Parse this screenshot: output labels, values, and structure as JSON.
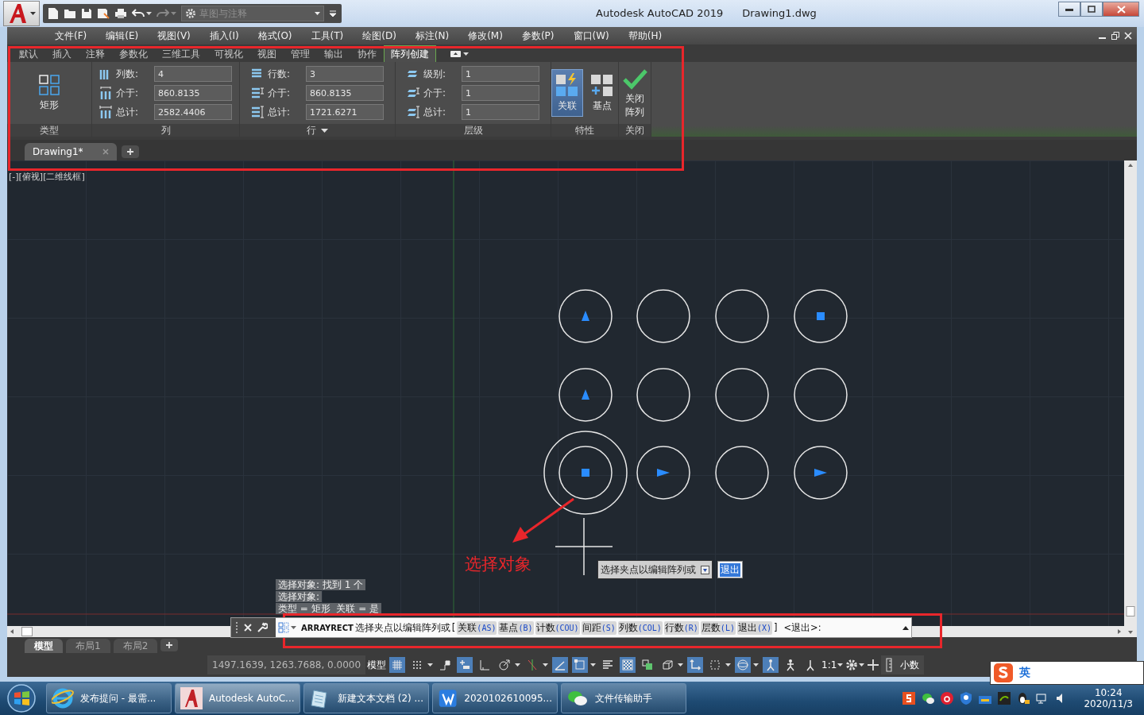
{
  "quick_access": {
    "workspace": "草图与注释"
  },
  "title": {
    "app": "Autodesk AutoCAD 2019",
    "file": "Drawing1.dwg"
  },
  "menu": [
    "文件(F)",
    "编辑(E)",
    "视图(V)",
    "插入(I)",
    "格式(O)",
    "工具(T)",
    "绘图(D)",
    "标注(N)",
    "修改(M)",
    "参数(P)",
    "窗口(W)",
    "帮助(H)"
  ],
  "ribbon": {
    "tabs": [
      {
        "label": "默认",
        "selected": false
      },
      {
        "label": "插入",
        "selected": false
      },
      {
        "label": "注释",
        "selected": false
      },
      {
        "label": "参数化",
        "selected": false
      },
      {
        "label": "三维工具",
        "selected": false
      },
      {
        "label": "可视化",
        "selected": false
      },
      {
        "label": "视图",
        "selected": false
      },
      {
        "label": "管理",
        "selected": false
      },
      {
        "label": "输出",
        "selected": false
      },
      {
        "label": "协作",
        "selected": false
      },
      {
        "label": "阵列创建",
        "selected": true
      }
    ],
    "panels": [
      {
        "kind": "type",
        "title": "类型",
        "label": "矩形"
      },
      {
        "kind": "fields",
        "title": "列",
        "expandable": false,
        "rows": [
          {
            "label": "列数:",
            "value": "4"
          },
          {
            "label": "介于:",
            "value": "860.8135"
          },
          {
            "label": "总计:",
            "value": "2582.4406"
          }
        ]
      },
      {
        "kind": "fields",
        "title": "行",
        "expandable": true,
        "rows": [
          {
            "label": "行数:",
            "value": "3"
          },
          {
            "label": "介于:",
            "value": "860.8135"
          },
          {
            "label": "总计:",
            "value": "1721.6271"
          }
        ]
      },
      {
        "kind": "fields",
        "title": "层级",
        "expandable": false,
        "rows": [
          {
            "label": "级别:",
            "value": "1"
          },
          {
            "label": "介于:",
            "value": "1"
          },
          {
            "label": "总计:",
            "value": "1"
          }
        ]
      },
      {
        "kind": "toggles",
        "title": "特性",
        "buttons": [
          {
            "label": "关联",
            "selected": true
          },
          {
            "label": "基点",
            "selected": false
          }
        ]
      },
      {
        "kind": "close",
        "title": "关闭",
        "label": "关闭阵列"
      }
    ]
  },
  "file_tabs": [
    {
      "label": "Drawing1*",
      "selected": true
    }
  ],
  "viewport_label": "[-][俯视][二维线框]",
  "history": [
    "选择对象: 找到 1 个",
    "选择对象:",
    "类型 = 矩形  关联 = 是"
  ],
  "annotation": "选择对象",
  "tooltip": {
    "prompt": "选择夹点以编辑阵列或",
    "value": "退出"
  },
  "command_line": {
    "command": "ARRAYRECT",
    "prompt": "选择夹点以编辑阵列或",
    "open": "[",
    "options": [
      {
        "label": "关联",
        "key": "(AS)"
      },
      {
        "label": "基点",
        "key": "(B)"
      },
      {
        "label": "计数",
        "key": "(COU)"
      },
      {
        "label": "间距",
        "key": "(S)"
      },
      {
        "label": "列数",
        "key": "(COL)"
      },
      {
        "label": "行数",
        "key": "(R)"
      },
      {
        "label": "层数",
        "key": "(L)"
      },
      {
        "label": "退出",
        "key": "(X)"
      }
    ],
    "close": "]",
    "default": "<退出>:"
  },
  "layout_tabs": [
    {
      "label": "模型",
      "selected": true
    },
    {
      "label": "布局1",
      "selected": false
    },
    {
      "label": "布局2",
      "selected": false
    }
  ],
  "status_bar": {
    "coordinates": "1497.1639, 1263.7688, 0.0000",
    "model": "模型",
    "scale": "1:1",
    "units": "小数",
    "buttons": [
      {
        "on": true,
        "caret": false
      },
      {
        "on": false,
        "caret": true
      },
      {
        "on": false,
        "caret": false
      },
      {
        "on": true,
        "caret": false
      },
      {
        "on": false,
        "caret": false
      },
      {
        "on": false,
        "caret": true
      },
      {
        "on": false,
        "caret": true
      },
      {
        "on": true,
        "caret": false
      },
      {
        "on": true,
        "caret": true
      },
      {
        "on": false,
        "caret": false
      },
      {
        "on": true,
        "caret": false
      },
      {
        "on": false,
        "caret": false
      },
      {
        "on": false,
        "caret": true
      },
      {
        "on": true,
        "caret": false
      },
      {
        "on": false,
        "caret": true
      },
      {
        "on": true,
        "caret": true
      },
      {
        "on": true,
        "caret": false
      },
      {
        "on": false,
        "caret": false
      },
      {
        "on": false,
        "caret": false
      }
    ]
  },
  "ime": {
    "mode": "英"
  },
  "taskbar": {
    "apps": [
      {
        "label": "发布提问 - 最需...",
        "selected": false
      },
      {
        "label": "Autodesk AutoC...",
        "selected": true
      },
      {
        "label": "新建文本文档 (2) ...",
        "selected": false
      },
      {
        "label": "2020102610095...",
        "selected": false
      },
      {
        "label": "文件传输助手",
        "selected": false
      }
    ],
    "time": "10:24",
    "date": "2020/11/3"
  }
}
